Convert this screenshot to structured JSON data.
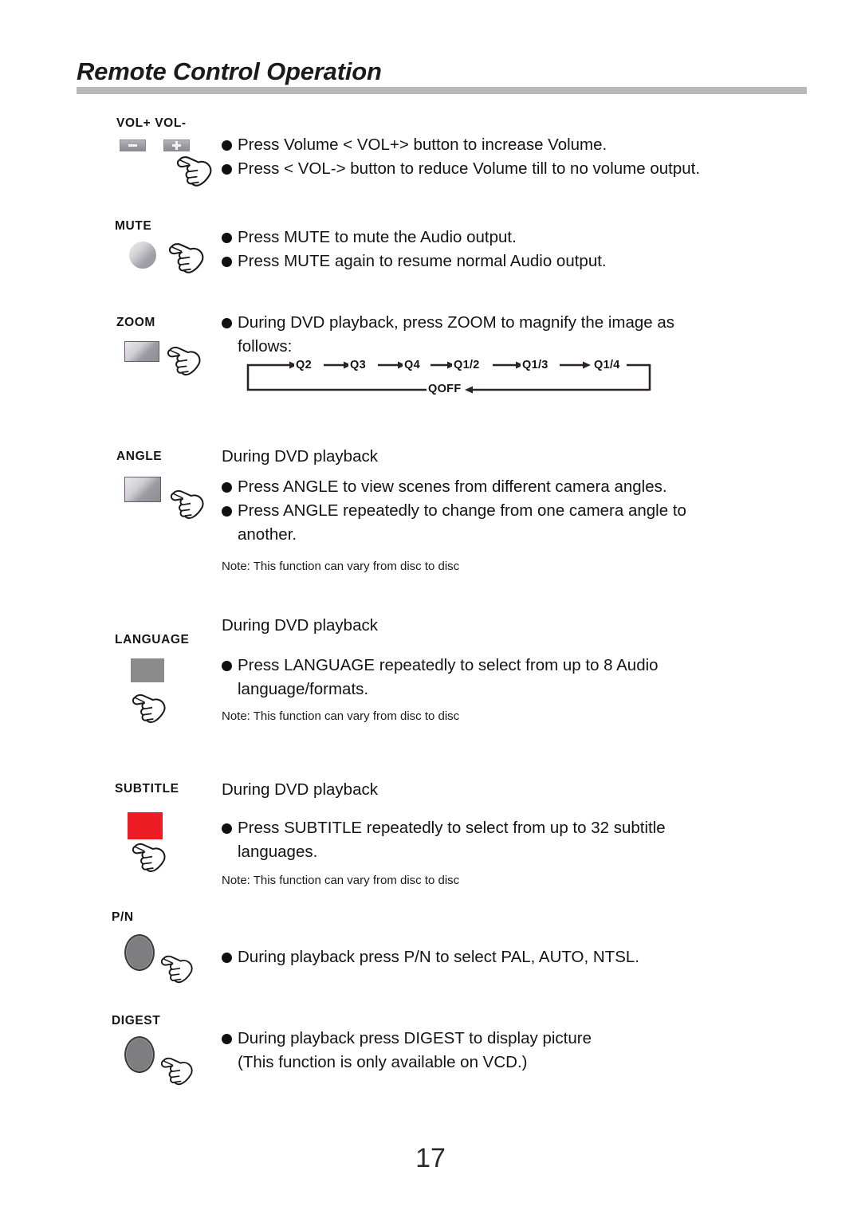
{
  "header": {
    "title": "Remote Control Operation"
  },
  "page_number": "17",
  "colors": {
    "subtitle_key": "#ed1c24",
    "language_key": "#8b8b8b",
    "header_rule": "#b9b9b9",
    "dark_key": "#7e7e80"
  },
  "sections": {
    "volume": {
      "label": "VOL+ VOL-",
      "key_minus_icon": "minus-icon",
      "key_plus_icon": "plus-icon",
      "hand_icon": "pointing-hand-icon",
      "bullets": [
        "Press Volume < VOL+> button to increase Volume.",
        "Press  < VOL-> button to reduce Volume till to no volume output."
      ]
    },
    "mute": {
      "label": "MUTE",
      "hand_icon": "pointing-hand-icon",
      "bullets": [
        "Press  MUTE to mute the Audio output.",
        "Press  MUTE again to resume normal Audio output."
      ]
    },
    "zoom": {
      "label": "ZOOM",
      "hand_icon": "pointing-hand-icon",
      "bullets": [
        "During DVD playback, press ZOOM to magnify the image as"
      ],
      "bullet_continuation": "follows:",
      "flow": {
        "top_steps": [
          "Q2",
          "Q3",
          "Q4",
          "Q1/2",
          "Q1/3",
          "Q1/4"
        ],
        "bottom_step": "QOFF"
      }
    },
    "angle": {
      "label": "ANGLE",
      "hand_icon": "pointing-hand-icon",
      "intro": "During DVD playback",
      "bullets": [
        "Press  ANGLE to view scenes from different camera angles.",
        "Press  ANGLE repeatedly to change from one camera angle to"
      ],
      "bullet_continuation": "another.",
      "note": "Note: This function can vary from disc to disc"
    },
    "language": {
      "label": "LANGUAGE",
      "hand_icon": "pointing-hand-icon",
      "intro": "During DVD playback",
      "bullets": [
        "Press  LANGUAGE repeatedly to select from up to 8 Audio"
      ],
      "bullet_continuation": "language/formats.",
      "note": "Note: This function can vary from disc to disc"
    },
    "subtitle": {
      "label": "SUBTITLE",
      "hand_icon": "pointing-hand-icon",
      "intro": "During DVD playback",
      "bullets": [
        "Press  SUBTITLE repeatedly to select from up to 32 subtitle"
      ],
      "bullet_continuation": "languages.",
      "note": "Note: This function can vary from disc to disc"
    },
    "pn": {
      "label": "P/N",
      "hand_icon": "pointing-hand-icon",
      "bullets": [
        "During playback press P/N to select PAL, AUTO, NTSL."
      ]
    },
    "digest": {
      "label": "DIGEST",
      "hand_icon": "pointing-hand-icon",
      "bullets": [
        "During playback press DIGEST to display picture"
      ],
      "bullet_continuation": "(This function is only available on VCD.)"
    }
  }
}
